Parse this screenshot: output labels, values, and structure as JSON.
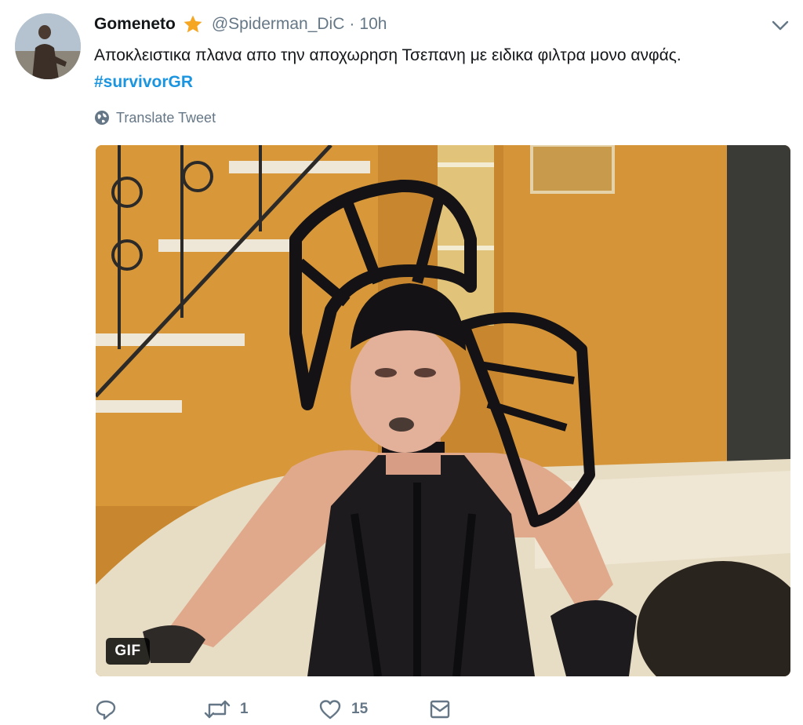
{
  "tweet": {
    "display_name": "Gomeneto",
    "handle": "@Spiderman_DiC",
    "separator": "·",
    "time": "10h",
    "text_main": "Αποκλειστικα πλανα απο την αποχωρηση Τσεπανη με ειδικα φιλτρα μονο ανφάς.",
    "hashtag": "#survivorGR",
    "translate_label": "Translate Tweet",
    "media_badge": "GIF"
  },
  "actions": {
    "reply_count": "",
    "retweet_count": "1",
    "like_count": "15"
  },
  "icons": {
    "verified": "star-icon",
    "menu": "chevron-down-icon",
    "translate": "globe-icon",
    "reply": "reply-icon",
    "retweet": "retweet-icon",
    "like": "heart-icon",
    "dm": "envelope-icon"
  },
  "colors": {
    "link": "#1b95e0",
    "muted": "#657786",
    "star": "#f5a623"
  }
}
